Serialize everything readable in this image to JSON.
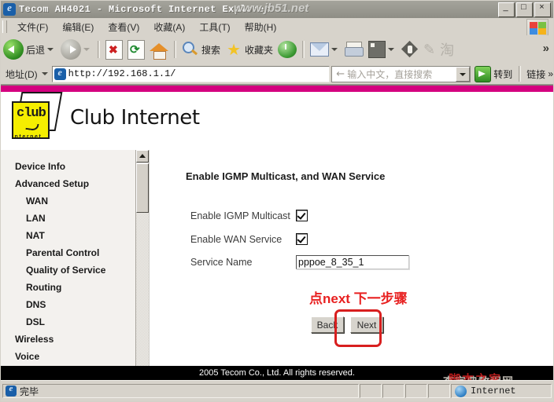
{
  "window": {
    "title": "Tecom AH4021 - Microsoft Internet Explorer",
    "watermark_top": "www.jb51.net",
    "minimize": "_",
    "maximize": "□",
    "close": "×"
  },
  "menu": {
    "items": [
      {
        "label": "文件(F)"
      },
      {
        "label": "编辑(E)"
      },
      {
        "label": "查看(V)"
      },
      {
        "label": "收藏(A)"
      },
      {
        "label": "工具(T)"
      },
      {
        "label": "帮助(H)"
      }
    ]
  },
  "toolbar": {
    "back_label": "后退",
    "forward_label": "",
    "stop_icon": "stop-icon",
    "refresh_icon": "refresh-icon",
    "home_icon": "home-icon",
    "search_label": "搜索",
    "favorites_label": "收藏夹",
    "history_icon": "history-icon",
    "mail_icon": "mail-icon",
    "print_icon": "print-icon",
    "edit_icon": "edit-icon",
    "messenger_icon": "messenger-icon",
    "overflow": "»"
  },
  "address": {
    "label": "地址(D)",
    "url": "http://192.168.1.1/",
    "search_placeholder": "输入中文，直接搜索",
    "go_label": "转到",
    "links_label": "链接",
    "overflow": "»"
  },
  "brand": {
    "cube_text": "club",
    "cube_sub": "internet",
    "title": "Club Internet",
    "accent_color": "#d4007f",
    "cube_color": "#f5ee00"
  },
  "sidebar": {
    "items": [
      {
        "label": "Device Info",
        "sub": false
      },
      {
        "label": "Advanced Setup",
        "sub": false
      },
      {
        "label": "WAN",
        "sub": true
      },
      {
        "label": "LAN",
        "sub": true
      },
      {
        "label": "NAT",
        "sub": true
      },
      {
        "label": "Parental Control",
        "sub": true
      },
      {
        "label": "Quality of Service",
        "sub": true
      },
      {
        "label": "Routing",
        "sub": true
      },
      {
        "label": "DNS",
        "sub": true
      },
      {
        "label": "DSL",
        "sub": true
      },
      {
        "label": "Wireless",
        "sub": false
      },
      {
        "label": "Voice",
        "sub": false
      }
    ]
  },
  "main": {
    "heading": "Enable IGMP Multicast, and WAN Service",
    "fields": [
      {
        "label": "Enable IGMP Multicast",
        "type": "checkbox",
        "checked": true
      },
      {
        "label": "Enable WAN Service",
        "type": "checkbox",
        "checked": true
      },
      {
        "label": "Service Name",
        "type": "text",
        "value": "pppoe_8_35_1"
      }
    ],
    "annotation": "点next 下一步骤",
    "annotation_color": "#e82020",
    "back_label": "Back",
    "next_label": "Next",
    "highlight_color": "#d81f1f"
  },
  "footer": {
    "copyright": "2005 Tecom Co., Ltd. All rights reserved."
  },
  "status": {
    "text": "完毕",
    "zone": "Internet",
    "watermark": "脚本之家",
    "watermark_grey": "查字典教程网",
    "watermark_url": "www.jb51.net"
  }
}
